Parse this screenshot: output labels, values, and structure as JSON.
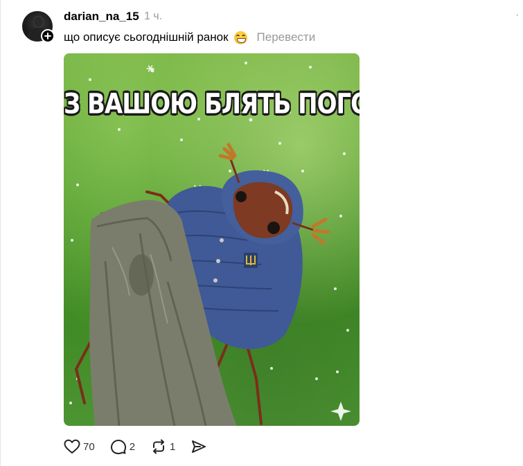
{
  "post": {
    "username": "darian_na_15",
    "time": "1 ч.",
    "more_label": "·",
    "caption": "що описує сьогоднішній ранок",
    "emoji": "grinning-face-emoji",
    "translate_label": "Перевести",
    "image": {
      "overlay_text": "З ВАШОЮ БЛЯТЬ ПОГОДОЮ",
      "alt": "beetle in blue puffer jacket on tree stump in snow"
    }
  },
  "actions": {
    "like": {
      "icon": "heart-icon",
      "count": "70"
    },
    "reply": {
      "icon": "comment-icon",
      "count": "2"
    },
    "repost": {
      "icon": "repost-icon",
      "count": "1"
    },
    "share": {
      "icon": "send-icon"
    }
  },
  "colors": {
    "text": "#000000",
    "muted": "#999999",
    "background": "#ffffff",
    "jacket": "#3f5a96"
  }
}
